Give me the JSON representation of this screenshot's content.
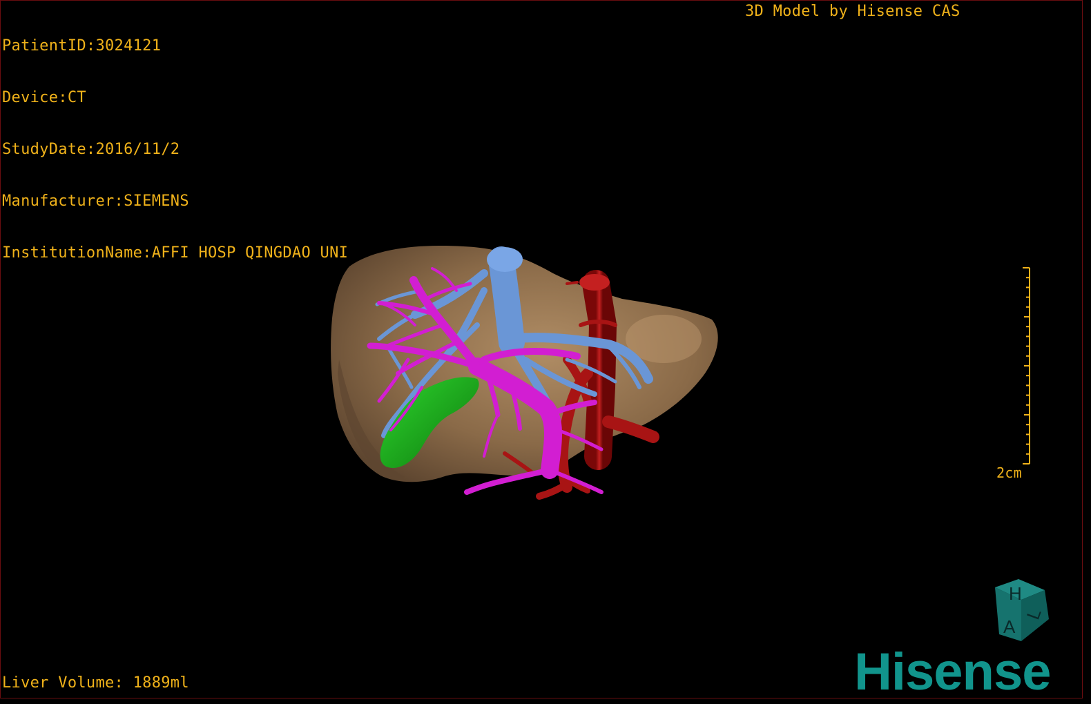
{
  "info": {
    "patient_id": "PatientID:3024121",
    "device": "Device:CT",
    "study_date": "StudyDate:2016/11/2",
    "manufacturer": "Manufacturer:SIEMENS",
    "institution": "InstitutionName:AFFI HOSP QINGDAO UNI"
  },
  "header": {
    "brand_title": "3D Model by Hisense CAS"
  },
  "footer": {
    "liver_volume": "Liver Volume: 1889ml"
  },
  "scale_bar": {
    "label": "2cm"
  },
  "orientation_cube": {
    "face_top": "H",
    "face_front": "A",
    "face_side": "L"
  },
  "logo": {
    "text": "Hisense"
  },
  "model": {
    "structures": [
      {
        "name": "liver",
        "color": "#8a6a48"
      },
      {
        "name": "hepatic-vein",
        "color": "#6a96d6"
      },
      {
        "name": "portal-vein",
        "color": "#d21ed2"
      },
      {
        "name": "hepatic-artery",
        "color": "#a81414"
      },
      {
        "name": "gallbladder",
        "color": "#1aa81a"
      }
    ]
  },
  "colors": {
    "background": "#000000",
    "overlay_text": "#f0b21a",
    "border": "#6a0d10",
    "brand": "#11948c"
  }
}
